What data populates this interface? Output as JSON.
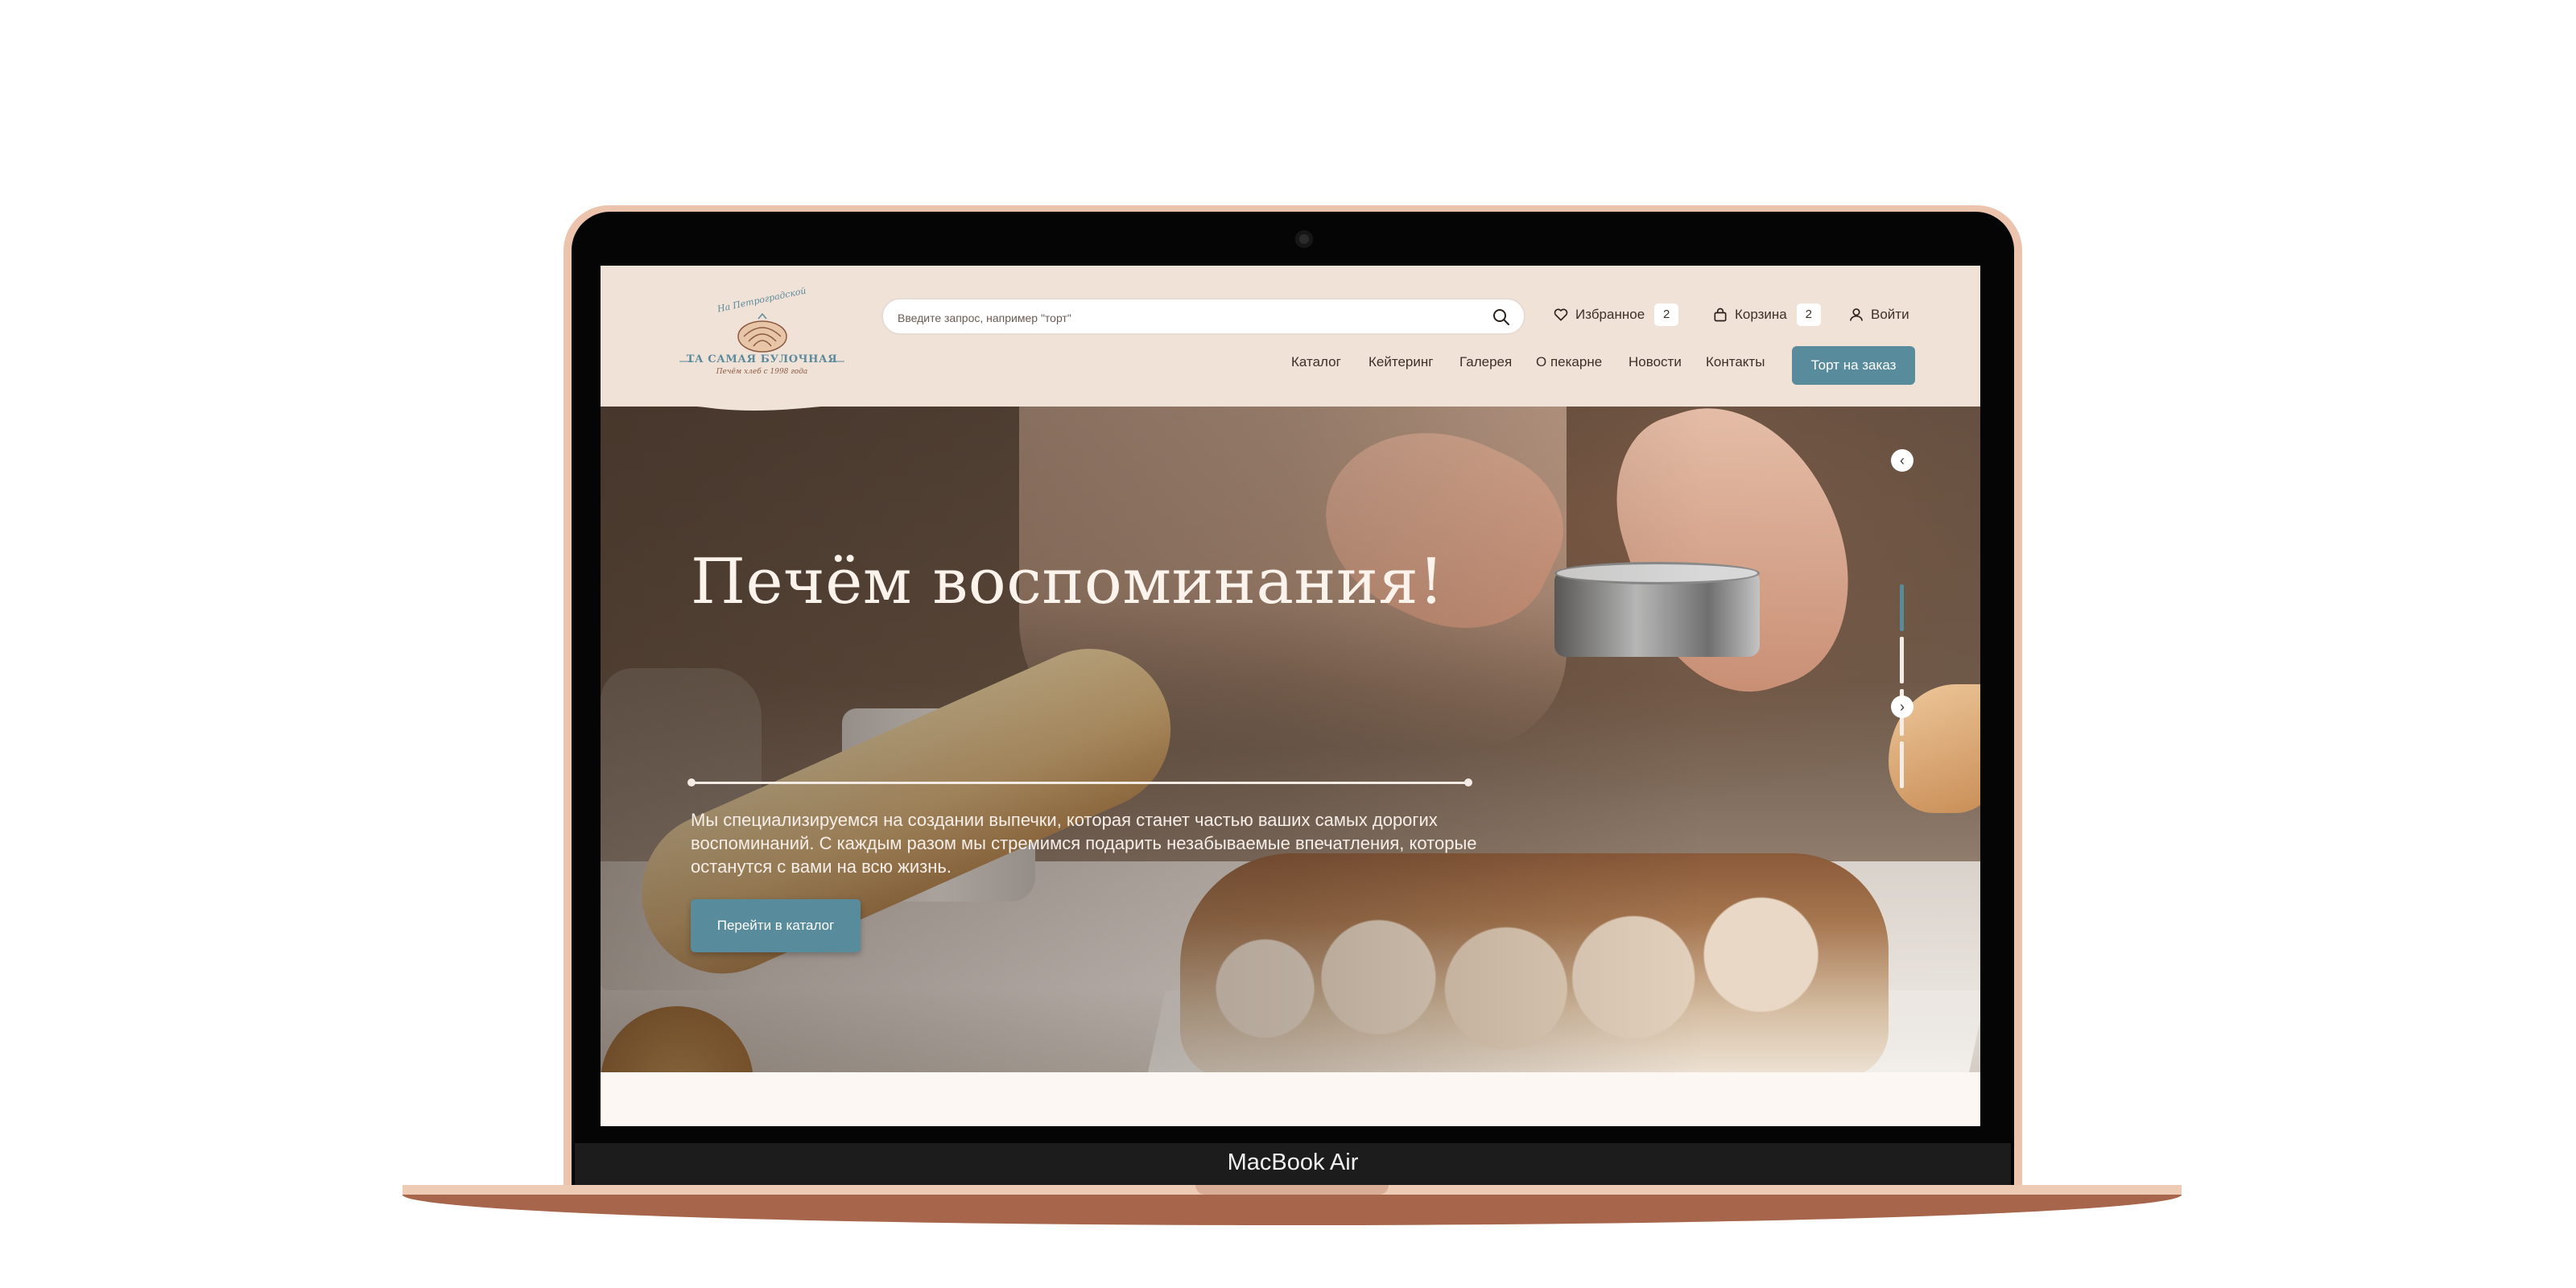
{
  "device": {
    "label": "MacBook Air"
  },
  "logo": {
    "script": "На Петроградской",
    "name": "ТА САМАЯ БУЛОЧНАЯ",
    "tagline": "Печём хлеб с 1998 года"
  },
  "search": {
    "placeholder": "Введите запрос, например \"торт\"",
    "icon": "search-icon"
  },
  "header": {
    "favorites": {
      "label": "Избранное",
      "count": "2",
      "icon": "heart-icon"
    },
    "cart": {
      "label": "Корзина",
      "count": "2",
      "icon": "bag-icon"
    },
    "login": {
      "label": "Войти",
      "icon": "user-icon"
    }
  },
  "nav": {
    "items": [
      {
        "label": "Каталог"
      },
      {
        "label": "Кейтеринг"
      },
      {
        "label": "Галерея"
      },
      {
        "label": "О пекарне"
      },
      {
        "label": "Новости"
      },
      {
        "label": "Контакты"
      }
    ],
    "cta": "Торт на заказ"
  },
  "hero": {
    "title": "Печём воспоминания!",
    "text": "Мы специализируемся на создании выпечки, которая станет частью ваших самых дорогих воспоминаний. С каждым разом мы стремимся подарить незабываемые впечатления, которые останутся с вами на всю жизнь.",
    "button": "Перейти в каталог"
  },
  "slider": {
    "prev_icon": "‹",
    "next_icon": "›",
    "total": 4,
    "active": 1
  },
  "colors": {
    "accent": "#588b9b",
    "header_bg": "#f1e2d8",
    "text_dark": "#3e2f27"
  }
}
